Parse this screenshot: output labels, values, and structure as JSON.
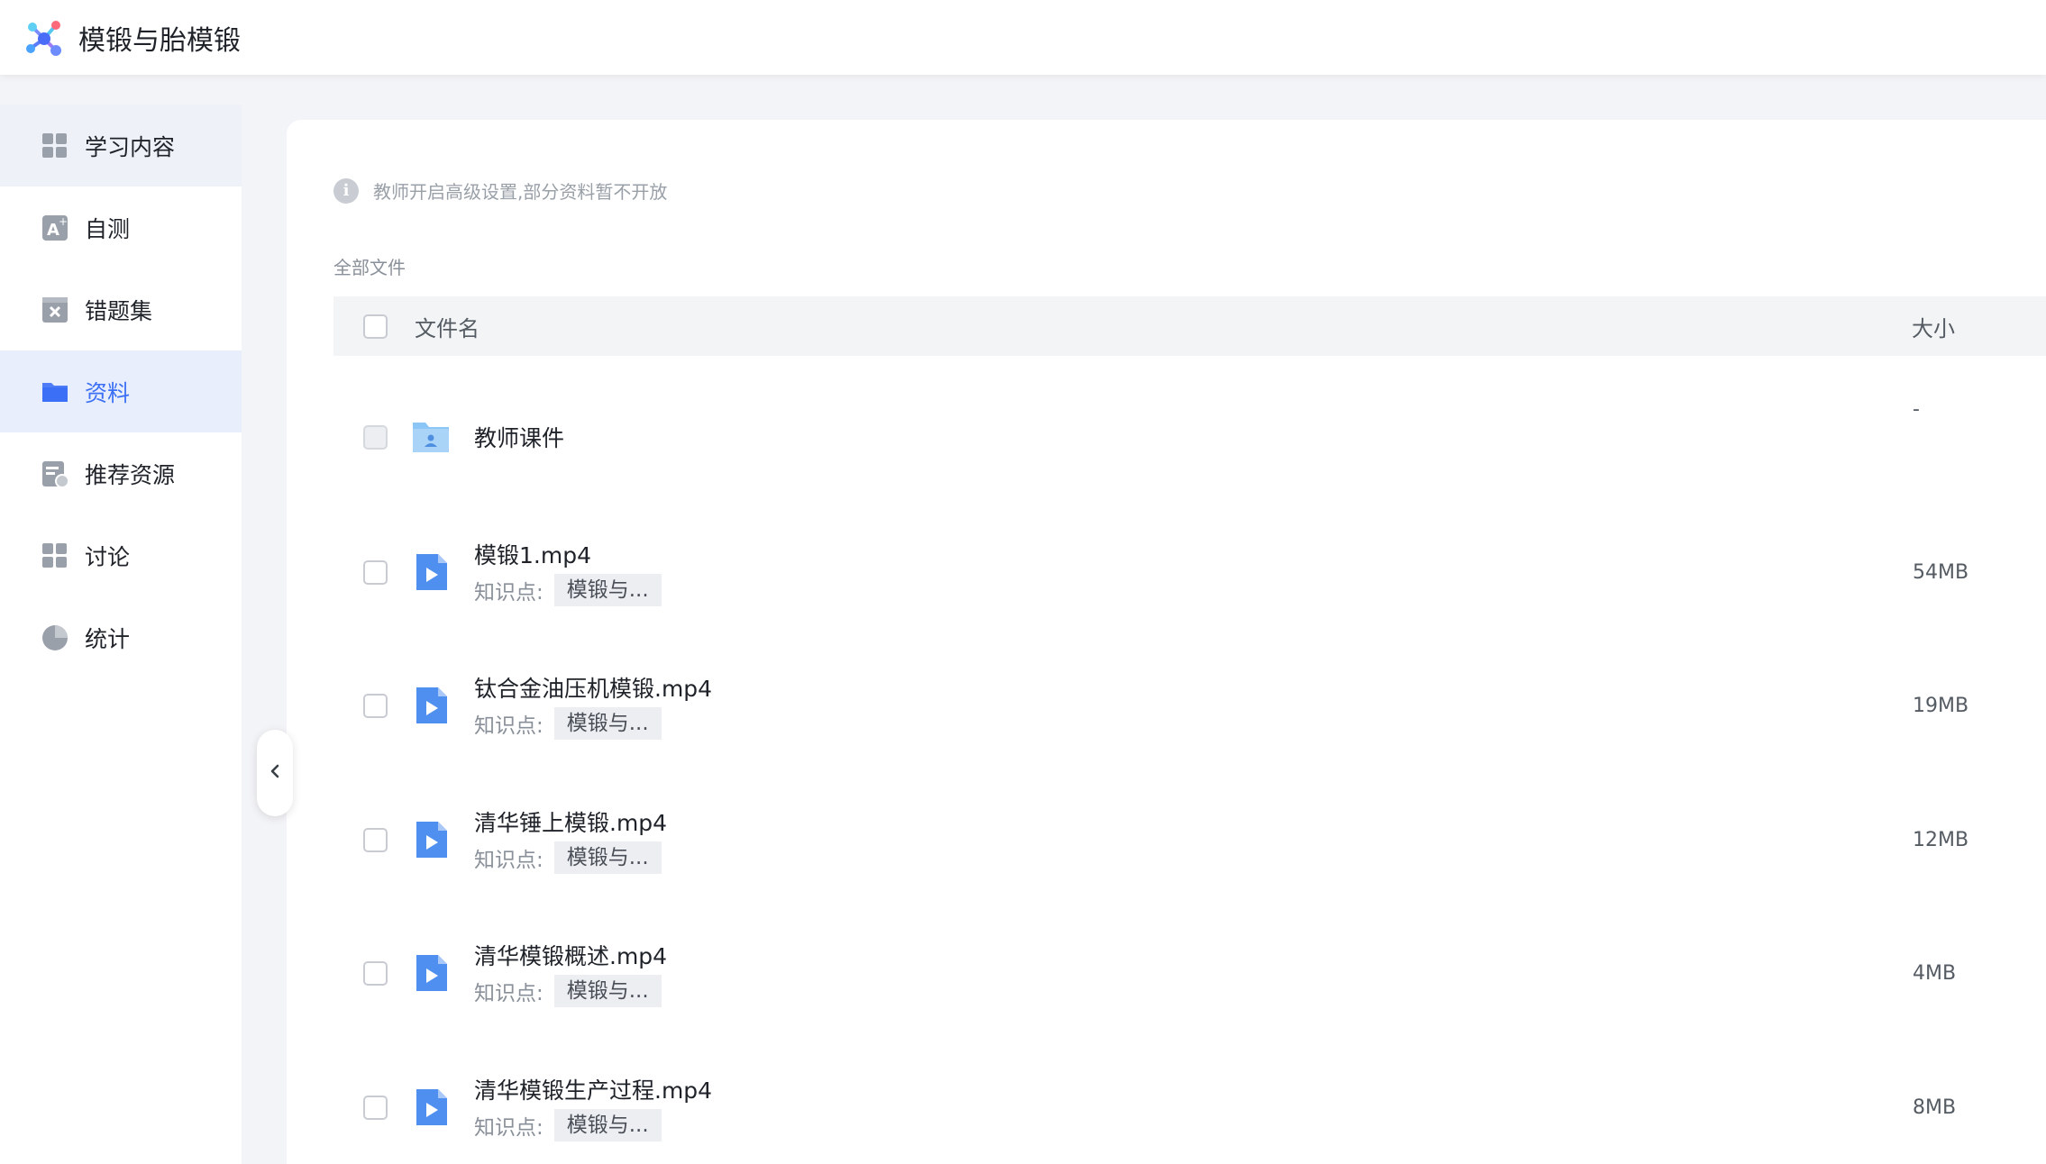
{
  "header": {
    "title": "模锻与胎模锻"
  },
  "sidebar": {
    "items": [
      {
        "label": "学习内容",
        "icon": "grid-icon"
      },
      {
        "label": "自测",
        "icon": "self-test-icon"
      },
      {
        "label": "错题集",
        "icon": "wrong-book-icon"
      },
      {
        "label": "资料",
        "icon": "folder-icon",
        "active": true
      },
      {
        "label": "推荐资源",
        "icon": "recommend-icon"
      },
      {
        "label": "讨论",
        "icon": "discussion-icon"
      },
      {
        "label": "统计",
        "icon": "pie-chart-icon"
      }
    ]
  },
  "notice": "教师开启高级设置,部分资料暂不开放",
  "breadcrumb": "全部文件",
  "table": {
    "columns": {
      "name": "文件名",
      "size": "大小"
    },
    "folder": {
      "name": "教师课件",
      "size": "-"
    },
    "kp_label": "知识点:",
    "files": [
      {
        "name": "模锻1.mp4",
        "tag": "模锻与...",
        "size": "54MB"
      },
      {
        "name": "钛合金油压机模锻.mp4",
        "tag": "模锻与...",
        "size": "19MB"
      },
      {
        "name": "清华锤上模锻.mp4",
        "tag": "模锻与...",
        "size": "12MB"
      },
      {
        "name": "清华模锻概述.mp4",
        "tag": "模锻与...",
        "size": "4MB"
      },
      {
        "name": "清华模锻生产过程.mp4",
        "tag": "模锻与...",
        "size": "8MB"
      }
    ]
  },
  "colors": {
    "accent": "#3b6ff5",
    "active_bg": "#e8eefb",
    "page_bg": "#f3f4f7"
  }
}
